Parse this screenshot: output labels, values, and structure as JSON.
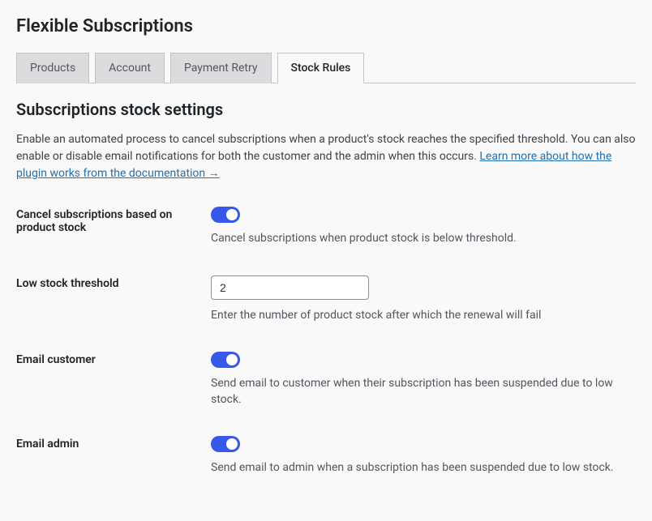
{
  "page_title": "Flexible Subscriptions",
  "tabs": [
    {
      "label": "Products",
      "active": false
    },
    {
      "label": "Account",
      "active": false
    },
    {
      "label": "Payment Retry",
      "active": false
    },
    {
      "label": "Stock Rules",
      "active": true
    }
  ],
  "section": {
    "title": "Subscriptions stock settings",
    "intro_text": "Enable an automated process to cancel subscriptions when a product's stock reaches the specified threshold. You can also enable or disable email notifications for both the customer and the admin when this occurs. ",
    "link_text": "Learn more about how the plugin works from the documentation →"
  },
  "settings": {
    "cancel_subscriptions": {
      "label": "Cancel subscriptions based on product stock",
      "enabled": true,
      "description": "Cancel subscriptions when product stock is below threshold."
    },
    "low_stock_threshold": {
      "label": "Low stock threshold",
      "value": "2",
      "description": "Enter the number of product stock after which the renewal will fail"
    },
    "email_customer": {
      "label": "Email customer",
      "enabled": true,
      "description": "Send email to customer when their subscription has been suspended due to low stock."
    },
    "email_admin": {
      "label": "Email admin",
      "enabled": true,
      "description": "Send email to admin when a subscription has been suspended due to low stock."
    }
  }
}
